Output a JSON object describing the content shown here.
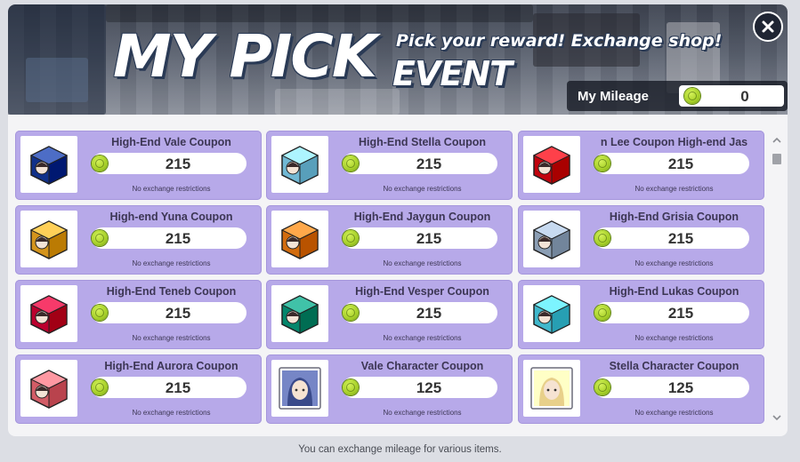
{
  "banner": {
    "title": "MY PICK",
    "subtitle": "Pick your reward! Exchange shop!",
    "event": "EVENT"
  },
  "close_icon": "close-icon",
  "mileage": {
    "label": "My Mileage",
    "value": "0",
    "icon": "mileage-coin-icon"
  },
  "items": [
    {
      "name": "High-End Vale Coupon",
      "price": "215",
      "note": "No exchange restrictions",
      "color": "#2f4fa8",
      "kind": "cube"
    },
    {
      "name": "High-End Stella Coupon",
      "price": "215",
      "note": "No exchange restrictions",
      "color": "#8fd6f2",
      "kind": "cube"
    },
    {
      "name": "n Lee Coupon    High-end Jas",
      "price": "215",
      "note": "No exchange restrictions",
      "color": "#e0222c",
      "kind": "cube"
    },
    {
      "name": "High-end Yuna Coupon",
      "price": "215",
      "note": "No exchange restrictions",
      "color": "#f2b23a",
      "kind": "cube"
    },
    {
      "name": "High-End Jaygun Coupon",
      "price": "215",
      "note": "No exchange restrictions",
      "color": "#f08a2c",
      "kind": "cube"
    },
    {
      "name": "High-End Grisia Coupon",
      "price": "215",
      "note": "No exchange restrictions",
      "color": "#a9bcd2",
      "kind": "cube"
    },
    {
      "name": "High-End Teneb Coupon",
      "price": "215",
      "note": "No exchange restrictions",
      "color": "#d91c4c",
      "kind": "cube"
    },
    {
      "name": "High-End Vesper Coupon",
      "price": "215",
      "note": "No exchange restrictions",
      "color": "#22a48a",
      "kind": "cube"
    },
    {
      "name": "High-End Lukas Coupon",
      "price": "215",
      "note": "No exchange restrictions",
      "color": "#5ed6ea",
      "kind": "cube"
    },
    {
      "name": "High-End Aurora Coupon",
      "price": "215",
      "note": "No exchange restrictions",
      "color": "#f07a84",
      "kind": "cube"
    },
    {
      "name": "Vale Character Coupon",
      "price": "125",
      "note": "No exchange restrictions",
      "color": "#3a4a8a",
      "kind": "portrait"
    },
    {
      "name": "Stella Character Coupon",
      "price": "125",
      "note": "No exchange restrictions",
      "color": "#e8d08a",
      "kind": "portrait"
    }
  ],
  "footer": "You can exchange mileage for various items."
}
